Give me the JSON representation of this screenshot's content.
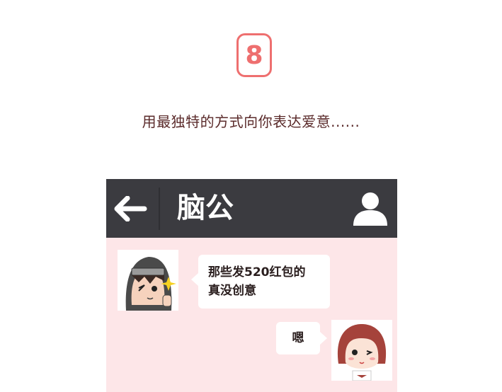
{
  "section": {
    "number": "8",
    "caption": "用最独特的方式向你表达爱意......",
    "accent_color": "#ee6f6f"
  },
  "chat": {
    "header": {
      "back_icon": "arrow-left-icon",
      "contact_name": "脑公",
      "profile_icon": "user-icon",
      "background": "#3b3b40"
    },
    "background": "#fde6e8",
    "messages": [
      {
        "sender": "left",
        "avatar": "hooded-boy-avatar",
        "lines": [
          "那些发520红包的",
          "真没创意"
        ]
      },
      {
        "sender": "right",
        "avatar": "bob-hair-girl-avatar",
        "lines": [
          "嗯"
        ]
      }
    ]
  }
}
